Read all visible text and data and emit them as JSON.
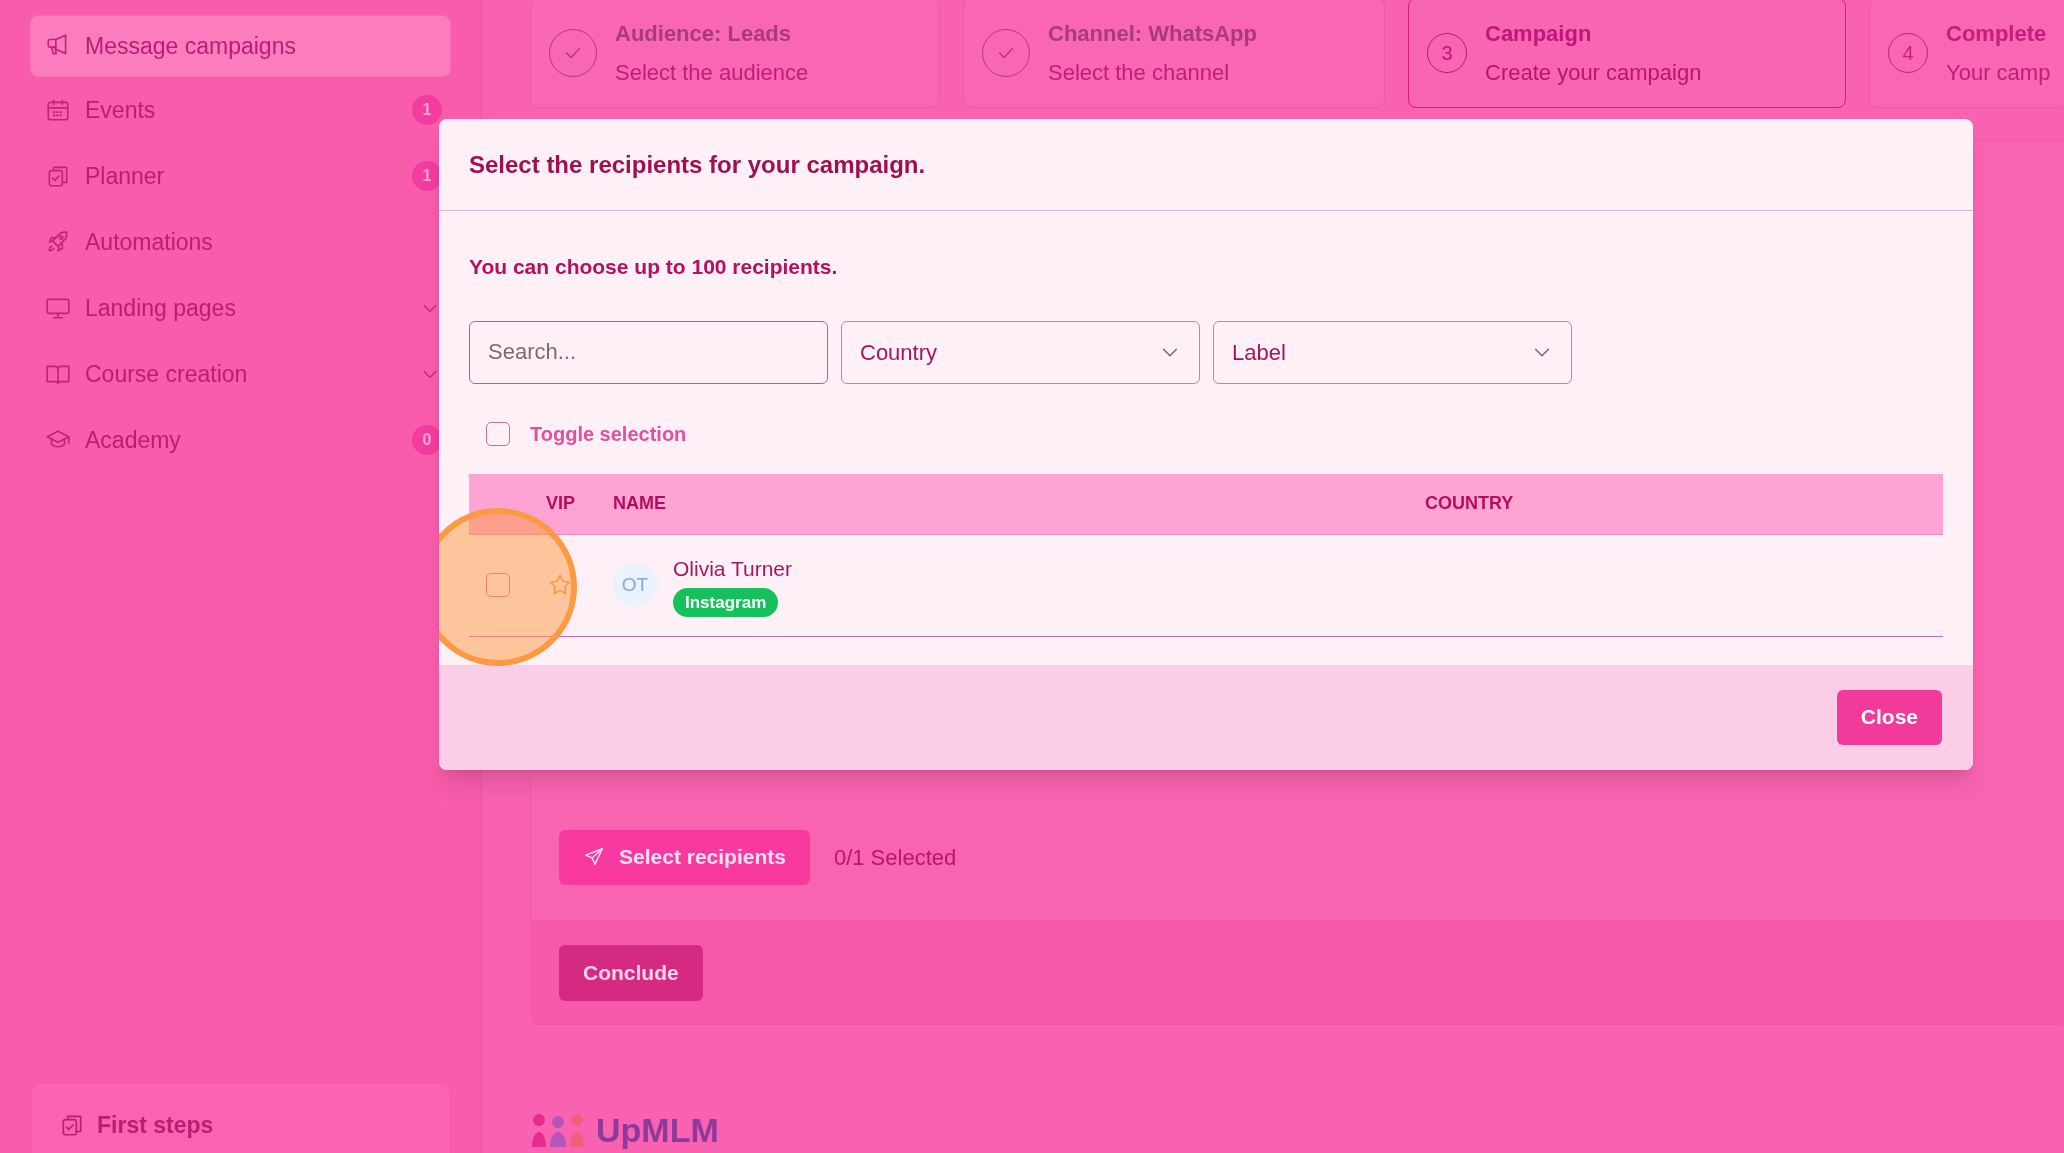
{
  "sidebar": {
    "items": [
      {
        "label": "Message campaigns",
        "selected": true
      },
      {
        "label": "Events",
        "selected": false,
        "badge": "1"
      },
      {
        "label": "Planner",
        "selected": false,
        "badge": "1"
      },
      {
        "label": "Automations",
        "selected": false
      },
      {
        "label": "Landing pages",
        "selected": false,
        "expandable": true
      },
      {
        "label": "Course creation",
        "selected": false,
        "expandable": true
      },
      {
        "label": "Academy",
        "selected": false,
        "badge": "0"
      }
    ],
    "footer_item": {
      "label": "First steps"
    }
  },
  "steps": [
    {
      "title": "Audience: Leads",
      "subtitle": "Select the audience",
      "completed": true,
      "selected": false
    },
    {
      "title": "Channel: WhatsApp",
      "subtitle": "Select the channel",
      "completed": true,
      "selected": false
    },
    {
      "number": "3",
      "title": "Campaign",
      "subtitle": "Create your campaign",
      "completed": false,
      "selected": true
    },
    {
      "number": "4",
      "title": "Complete",
      "subtitle": "Your camp",
      "completed": false,
      "selected": false
    }
  ],
  "page": {
    "select_button": "Select recipients",
    "selected_count": "0/1 Selected",
    "conclude_button": "Conclude",
    "logo_text": "UpMLM"
  },
  "modal": {
    "title": "Select the recipients for your campaign.",
    "subtitle": "You can choose up to 100 recipients.",
    "search": {
      "placeholder": "Search..."
    },
    "filters": [
      {
        "label": "Country"
      },
      {
        "label": "Label"
      }
    ],
    "toggle_selection": {
      "label": "Toggle selection",
      "checked": false
    },
    "table": {
      "columns": [
        "VIP",
        "NAME",
        "COUNTRY"
      ],
      "rows": [
        {
          "checked": false,
          "vip": false,
          "highlighted": true,
          "initials": "OT",
          "name": "Olivia Turner",
          "tag": "Instagram"
        }
      ]
    },
    "close_button": "Close"
  }
}
